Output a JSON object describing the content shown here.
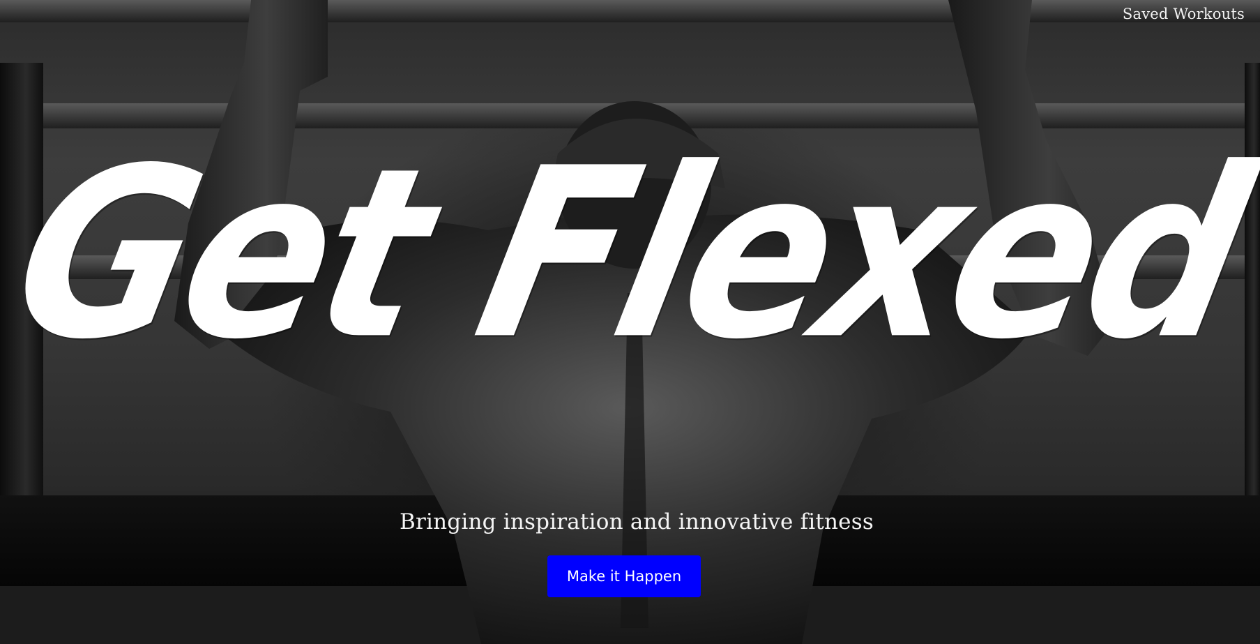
{
  "nav": {
    "saved_workouts_label": "Saved Workouts"
  },
  "hero": {
    "title": "Get Flexed",
    "subtitle": "Bringing inspiration and innovative fitness",
    "cta_label": "Make it Happen"
  },
  "colors": {
    "cta_background": "#0000ff",
    "text": "#ffffff"
  }
}
